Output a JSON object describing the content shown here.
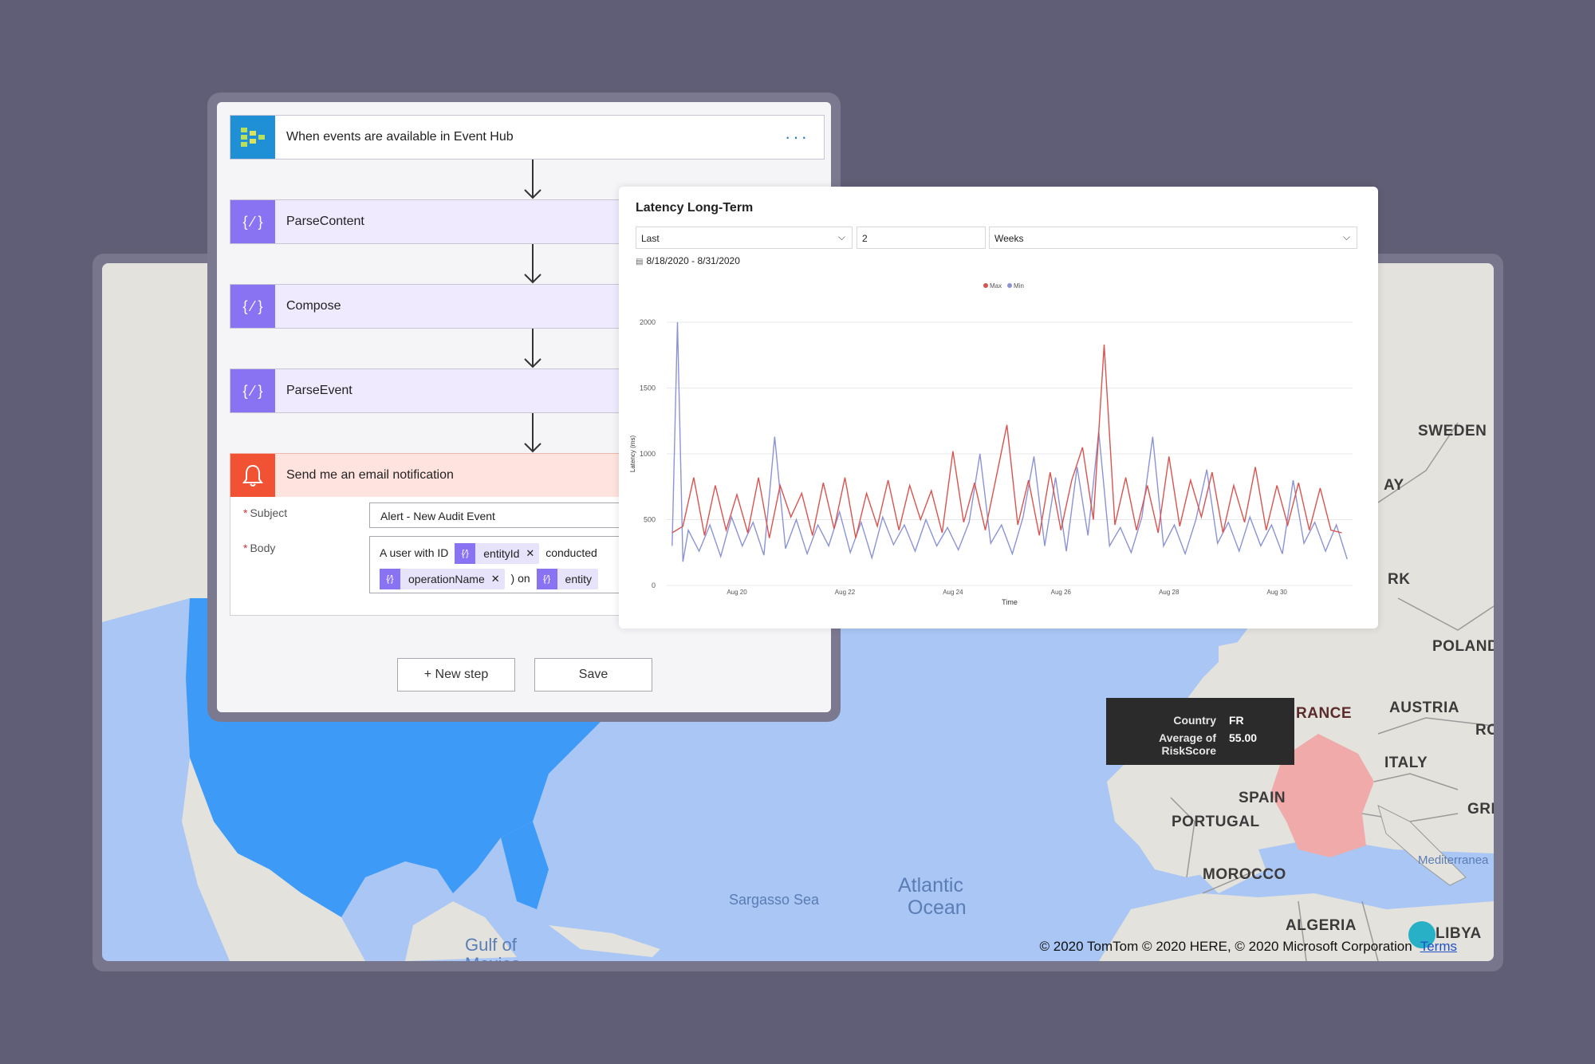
{
  "flow": {
    "trigger": {
      "label": "When events are available in Event Hub",
      "more_icon": "ellipsis-icon"
    },
    "steps": [
      {
        "label": "ParseContent"
      },
      {
        "label": "Compose"
      },
      {
        "label": "ParseEvent"
      }
    ],
    "notify": {
      "label": "Send me an email notification",
      "subject_label": "Subject",
      "subject_value": "Alert - New Audit Event",
      "body_label": "Body",
      "body_text_1": "A user with ID",
      "body_token_1": "entityId",
      "body_text_2": "conducted",
      "body_token_2": "operationName",
      "body_text_3": ") on",
      "body_token_3": "entity"
    },
    "new_step_label": "+ New step",
    "save_label": "Save"
  },
  "chart_panel": {
    "title": "Latency Long-Term",
    "filter_mode": "Last",
    "filter_count": "2",
    "filter_unit": "Weeks",
    "date_range": "8/18/2020 - 8/31/2020"
  },
  "chart_data": {
    "type": "line",
    "ylabel": "Latency (ms)",
    "xlabel": "Time",
    "ylim": [
      0,
      2000
    ],
    "yticks": [
      "0",
      "500",
      "1000",
      "1500",
      "2000"
    ],
    "xticks": [
      "Aug 20",
      "Aug 22",
      "Aug 24",
      "Aug 26",
      "Aug 28",
      "Aug 30"
    ],
    "xrange_days": [
      18.7,
      31.4
    ],
    "legend": [
      "Max",
      "Min"
    ],
    "legend_position": "top-center",
    "grid": true,
    "series": [
      {
        "name": "Max",
        "color": "#d9534f",
        "x": [
          18.8,
          19.0,
          19.2,
          19.4,
          19.6,
          19.8,
          20.0,
          20.2,
          20.4,
          20.6,
          20.8,
          21.0,
          21.2,
          21.4,
          21.6,
          21.8,
          22.0,
          22.2,
          22.4,
          22.6,
          22.8,
          23.0,
          23.2,
          23.4,
          23.6,
          23.8,
          24.0,
          24.2,
          24.4,
          24.6,
          24.8,
          25.0,
          25.2,
          25.4,
          25.6,
          25.8,
          26.0,
          26.2,
          26.4,
          26.6,
          26.8,
          27.0,
          27.2,
          27.4,
          27.6,
          27.8,
          28.0,
          28.2,
          28.4,
          28.6,
          28.8,
          29.0,
          29.2,
          29.4,
          29.6,
          29.8,
          30.0,
          30.2,
          30.4,
          30.6,
          30.8,
          31.0,
          31.2
        ],
        "y": [
          400,
          450,
          820,
          380,
          760,
          420,
          690,
          400,
          820,
          360,
          760,
          520,
          700,
          380,
          780,
          430,
          820,
          360,
          700,
          450,
          800,
          420,
          760,
          500,
          720,
          400,
          1020,
          480,
          780,
          420,
          820,
          1220,
          460,
          800,
          380,
          860,
          420,
          800,
          1050,
          500,
          1830,
          460,
          820,
          420,
          760,
          400,
          980,
          450,
          800,
          520,
          860,
          400,
          760,
          480,
          900,
          420,
          760,
          460,
          780,
          420,
          740,
          420,
          400
        ]
      },
      {
        "name": "Min",
        "color": "#8b93d6",
        "x": [
          18.8,
          18.9,
          19.0,
          19.1,
          19.3,
          19.5,
          19.7,
          19.9,
          20.1,
          20.3,
          20.5,
          20.7,
          20.9,
          21.1,
          21.3,
          21.5,
          21.7,
          21.9,
          22.1,
          22.3,
          22.5,
          22.7,
          22.9,
          23.1,
          23.3,
          23.5,
          23.7,
          23.9,
          24.1,
          24.3,
          24.5,
          24.7,
          24.9,
          25.1,
          25.3,
          25.5,
          25.7,
          25.9,
          26.1,
          26.3,
          26.5,
          26.7,
          26.9,
          27.1,
          27.3,
          27.5,
          27.7,
          27.9,
          28.1,
          28.3,
          28.5,
          28.7,
          28.9,
          29.1,
          29.3,
          29.5,
          29.7,
          29.9,
          30.1,
          30.3,
          30.5,
          30.7,
          30.9,
          31.1,
          31.3
        ],
        "y": [
          300,
          2000,
          180,
          420,
          260,
          460,
          220,
          520,
          300,
          480,
          230,
          1130,
          280,
          500,
          240,
          460,
          300,
          560,
          250,
          480,
          210,
          520,
          310,
          460,
          260,
          500,
          300,
          440,
          270,
          480,
          1000,
          320,
          460,
          240,
          520,
          980,
          300,
          820,
          260,
          900,
          380,
          1170,
          300,
          440,
          250,
          520,
          1130,
          300,
          460,
          240,
          500,
          880,
          320,
          480,
          260,
          520,
          300,
          460,
          240,
          800,
          320,
          480,
          260,
          460,
          200
        ]
      }
    ]
  },
  "map": {
    "labels": {
      "sweden": "SWEDEN",
      "norway": "AY",
      "denmark": "RK",
      "poland": "POLAND",
      "austria": "AUSTRIA",
      "romania": "RO",
      "italy": "ITALY",
      "spain": "SPAIN",
      "portugal": "PORTUGAL",
      "greece": "GRE",
      "morocco": "MOROCCO",
      "algeria": "ALGERIA",
      "libya": "LIBYA",
      "france": "RANCE"
    },
    "seas": {
      "sargasso": "Sargasso Sea",
      "atlantic_1": "Atlantic",
      "atlantic_2": "Ocean",
      "gulf_1": "Gulf of",
      "gulf_2": "Mexico",
      "mediterranean": "Mediterranea"
    },
    "tooltip": {
      "country_label": "Country",
      "country_value": "FR",
      "risk_label": "Average of RiskScore",
      "risk_value": "55.00"
    },
    "copyright": "© 2020 TomTom © 2020 HERE, © 2020 Microsoft Corporation",
    "terms_label": "Terms",
    "colors": {
      "usa": "#3d9bf7",
      "france": "#f0aaaa",
      "ocean": "#a9c6f4"
    }
  }
}
